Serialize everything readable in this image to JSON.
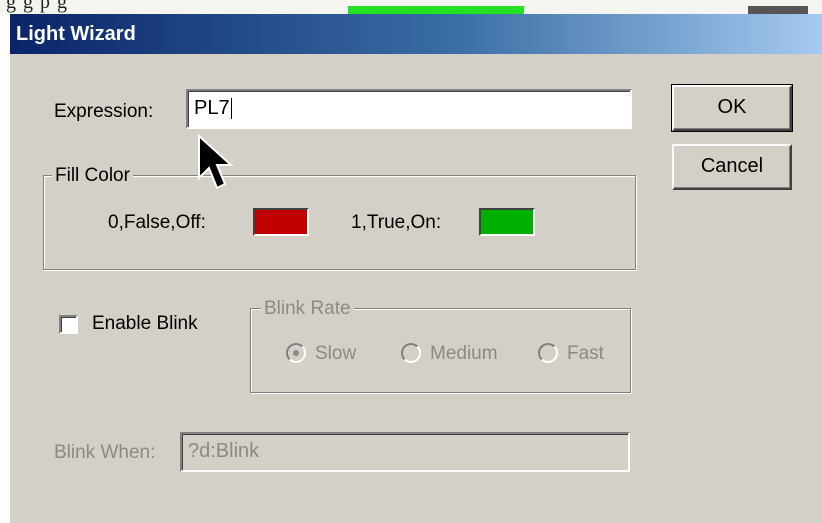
{
  "background": {
    "partial_text": "g  g       p                  g"
  },
  "dialog": {
    "title": "Light Wizard",
    "expression": {
      "label": "Expression:",
      "value": "PL7"
    },
    "buttons": {
      "ok": "OK",
      "cancel": "Cancel"
    },
    "fill_color": {
      "title": "Fill Color",
      "off_label": "0,False,Off:",
      "on_label": "1,True,On:",
      "off_color": "#c00000",
      "on_color": "#00b000"
    },
    "enable_blink": {
      "label": "Enable Blink",
      "checked": false
    },
    "blink_rate": {
      "title": "Blink Rate",
      "options": [
        "Slow",
        "Medium",
        "Fast"
      ],
      "selected": "Slow"
    },
    "blink_when": {
      "label": "Blink When:",
      "value": "?d:Blink"
    }
  },
  "icons": {
    "cursor": "mouse-pointer-icon"
  }
}
